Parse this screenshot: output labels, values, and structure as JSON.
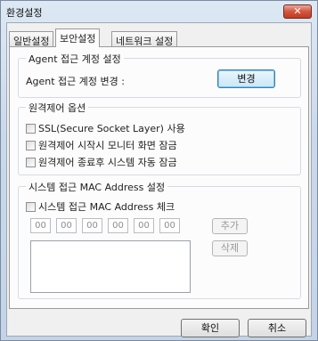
{
  "window": {
    "title": "환경설정",
    "close_label": "✕"
  },
  "tabs": [
    {
      "label": "일반설정",
      "active": false
    },
    {
      "label": "보안설정",
      "active": true
    },
    {
      "label": "네트워크 설정",
      "active": false
    }
  ],
  "agent_group": {
    "legend": "Agent 접근 계정 설정",
    "label": "Agent 접근 계정 변경 :",
    "button": "변경"
  },
  "remote_group": {
    "legend": "원격제어 옵션",
    "options": [
      "SSL(Secure Socket Layer) 사용",
      "원격제어 시작시 모니터 화면 잠금",
      "원격제어 종료후 시스템 자동 잠금"
    ]
  },
  "mac_group": {
    "legend": "시스템 접근 MAC Address 설정",
    "check_label": "시스템 접근 MAC Address 체크",
    "octets": [
      "00",
      "00",
      "00",
      "00",
      "00",
      "00"
    ],
    "add_button": "추가",
    "delete_button": "삭제"
  },
  "footer": {
    "ok": "확인",
    "cancel": "취소"
  }
}
